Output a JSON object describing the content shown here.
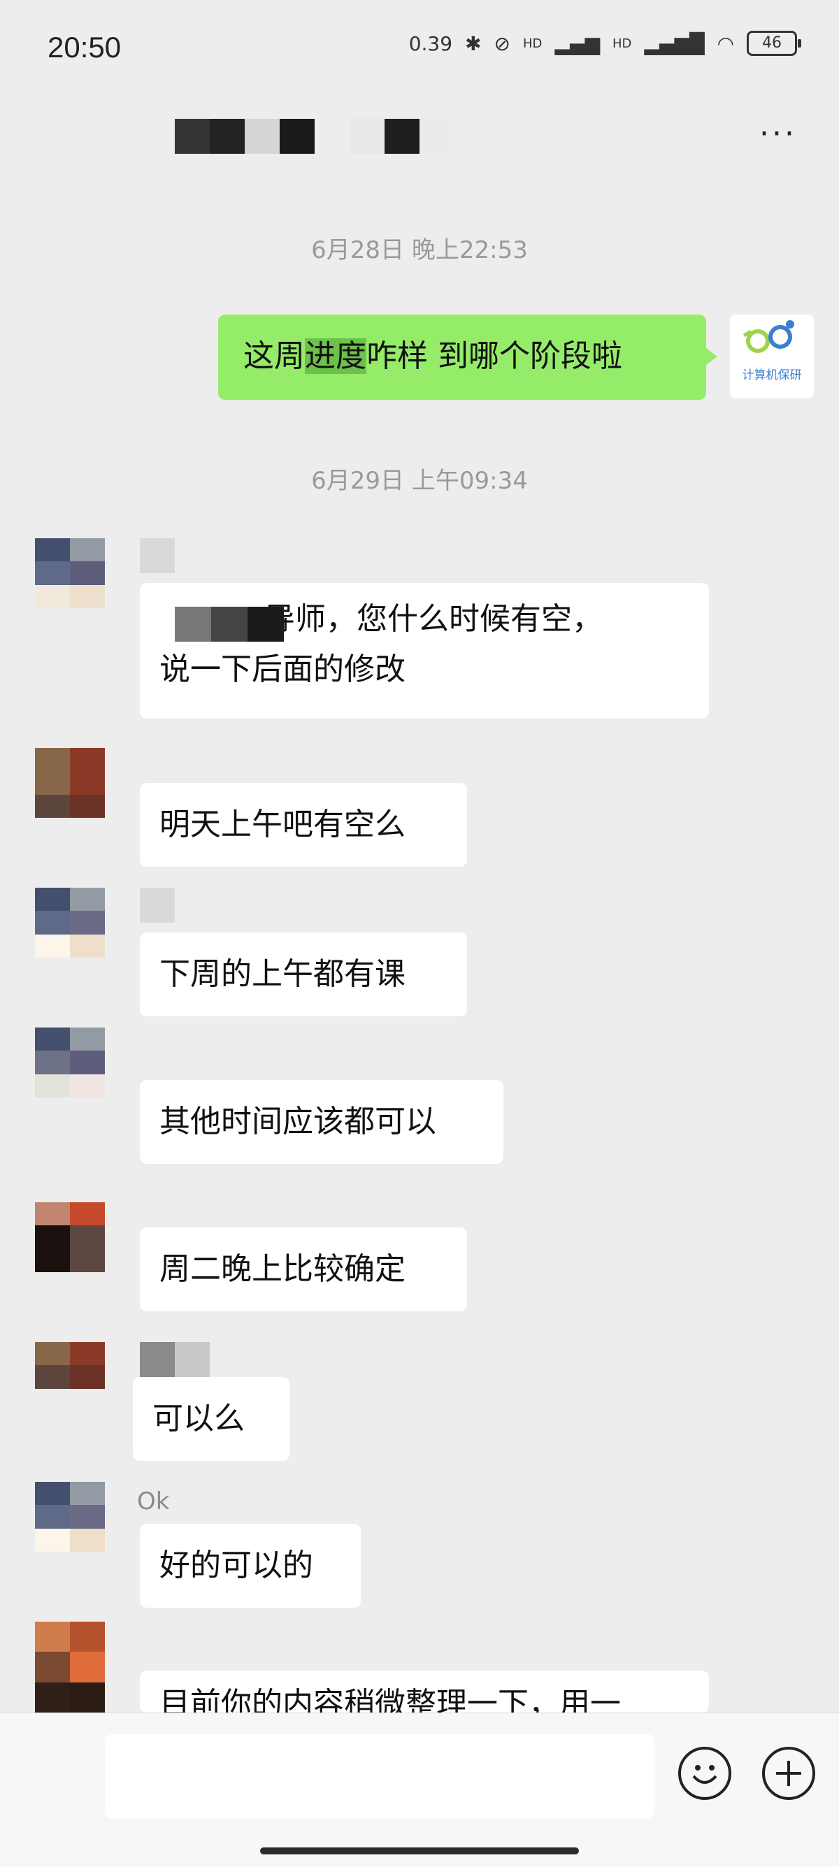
{
  "status_bar": {
    "time": "20:50",
    "speed": "0.39",
    "network_1": "HD",
    "network_2": "HD",
    "battery": "46"
  },
  "header": {
    "title": "",
    "more_label": "···"
  },
  "messages": {
    "ts1": "6月28日 晚上22:53",
    "self_msg_pre": "这周",
    "self_msg_hl": "进度",
    "self_msg_post": "咋样 到哪个阶段啦",
    "self_avatar_label": "计算机保研",
    "ts2": "6月29日 上午09:34",
    "m1_line1": "导师，您什么时候有空，",
    "m1_line2": "说一下后面的修改",
    "m2": "明天上午吧有空么",
    "m3": "下周的上午都有课",
    "m4": "其他时间应该都可以",
    "m5": "周二晚上比较确定",
    "m6": "可以么",
    "nick_ok": "Ok",
    "m7": "好的可以的",
    "m8": "目前你的内容稍微整理一下，用一"
  },
  "colors": {
    "self_bubble": "#95ec69",
    "highlight": "#6cc24a",
    "background": "#ededed"
  },
  "icons": {
    "emoji": "smiley-face-icon",
    "plus": "plus-circle-icon"
  }
}
